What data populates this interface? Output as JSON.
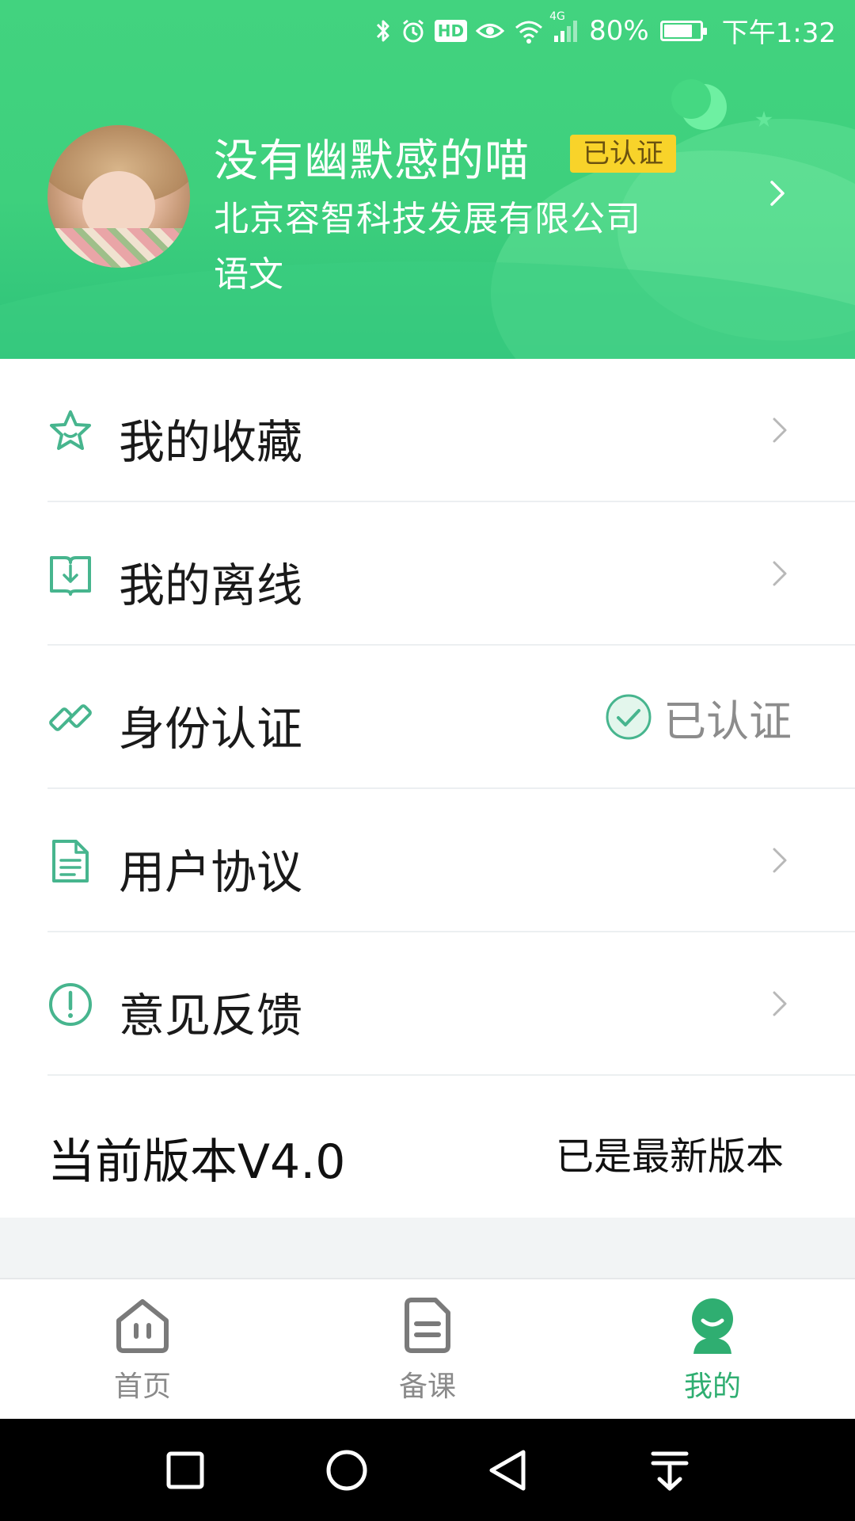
{
  "status_bar": {
    "battery": "80%",
    "battery_level": 0.8,
    "time": "下午1:32",
    "hd_label": "HD",
    "network_label": "4G",
    "icons": [
      "bluetooth-icon",
      "alarm-icon",
      "hd-icon",
      "eye-icon",
      "wifi-icon",
      "signal-icon",
      "battery-icon"
    ]
  },
  "profile": {
    "name": "没有幽默感的喵",
    "badge": "已认证",
    "company": "北京容智科技发展有限公司",
    "subject": "语文"
  },
  "menu": {
    "items": [
      {
        "label": "我的收藏",
        "icon": "star-icon"
      },
      {
        "label": "我的离线",
        "icon": "offline-book-icon"
      },
      {
        "label": "身份认证",
        "icon": "link-icon",
        "status": "已认证"
      },
      {
        "label": "用户协议",
        "icon": "document-icon"
      },
      {
        "label": "意见反馈",
        "icon": "exclamation-circle-icon"
      }
    ],
    "version": {
      "label": "当前版本V4.0",
      "status": "已是最新版本"
    }
  },
  "tabbar": {
    "tabs": [
      {
        "label": "首页",
        "icon": "home-icon",
        "active": false
      },
      {
        "label": "备课",
        "icon": "lesson-prep-icon",
        "active": false
      },
      {
        "label": "我的",
        "icon": "profile-icon",
        "active": true
      }
    ]
  },
  "colors": {
    "header_green": "#42d37f",
    "accent_green": "#2fae71",
    "icon_teal": "#47b58e",
    "badge_yellow": "#f8d32a",
    "divider": "#eceff1"
  }
}
